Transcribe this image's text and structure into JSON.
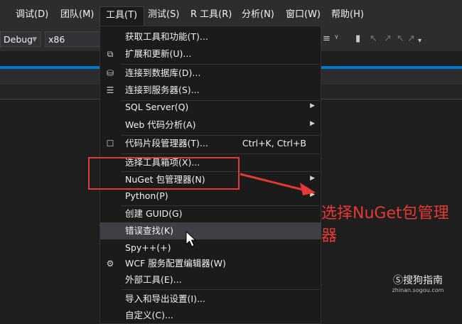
{
  "menubar": {
    "items": [
      {
        "label": "调试(D)"
      },
      {
        "label": "团队(M)"
      },
      {
        "label": "工具(T)"
      },
      {
        "label": "测试(S)"
      },
      {
        "label": "R 工具(R)"
      },
      {
        "label": "分析(N)"
      },
      {
        "label": "窗口(W)"
      },
      {
        "label": "帮助(H)"
      }
    ]
  },
  "toolbar": {
    "config": "Debug",
    "platform": "x86"
  },
  "tools_menu": {
    "items": [
      {
        "label": "获取工具和功能(T)...",
        "shortcut": "",
        "submenu": false,
        "icon": ""
      },
      {
        "label": "扩展和更新(U)...",
        "shortcut": "",
        "submenu": false,
        "icon": "extensions-icon"
      },
      {
        "label": "连接到数据库(D)...",
        "shortcut": "",
        "submenu": false,
        "icon": "database-icon"
      },
      {
        "label": "连接到服务器(S)...",
        "shortcut": "",
        "submenu": false,
        "icon": "server-icon"
      },
      {
        "label": "SQL Server(Q)",
        "shortcut": "",
        "submenu": true,
        "icon": ""
      },
      {
        "label": "Web 代码分析(A)",
        "shortcut": "",
        "submenu": true,
        "icon": ""
      },
      {
        "label": "代码片段管理器(T)...",
        "shortcut": "Ctrl+K, Ctrl+B",
        "submenu": false,
        "icon": "snippet-icon"
      },
      {
        "label": "选择工具箱项(X)...",
        "shortcut": "",
        "submenu": false,
        "icon": ""
      },
      {
        "label": "NuGet 包管理器(N)",
        "shortcut": "",
        "submenu": true,
        "icon": ""
      },
      {
        "label": "Python(P)",
        "shortcut": "",
        "submenu": true,
        "icon": ""
      },
      {
        "label": "创建 GUID(G)",
        "shortcut": "",
        "submenu": false,
        "icon": ""
      },
      {
        "label": "错误查找(K)",
        "shortcut": "",
        "submenu": false,
        "icon": ""
      },
      {
        "label": "Spy++(+)",
        "shortcut": "",
        "submenu": false,
        "icon": ""
      },
      {
        "label": "WCF 服务配置编辑器(W)",
        "shortcut": "",
        "submenu": false,
        "icon": "gear-icon"
      },
      {
        "label": "外部工具(E)...",
        "shortcut": "",
        "submenu": false,
        "icon": ""
      },
      {
        "label": "导入和导出设置(I)...",
        "shortcut": "",
        "submenu": false,
        "icon": ""
      },
      {
        "label": "自定义(C)...",
        "shortcut": "",
        "submenu": false,
        "icon": ""
      }
    ]
  },
  "annotation": {
    "text": "选择NuGet包管理器"
  },
  "watermark": {
    "brand": "搜狗指南",
    "url": "zhinan.sogou.com"
  },
  "colors": {
    "accent": "#007acc",
    "highlight": "#e53935",
    "menu_bg": "#1b1b1c",
    "hover_bg": "#3f3f46"
  }
}
